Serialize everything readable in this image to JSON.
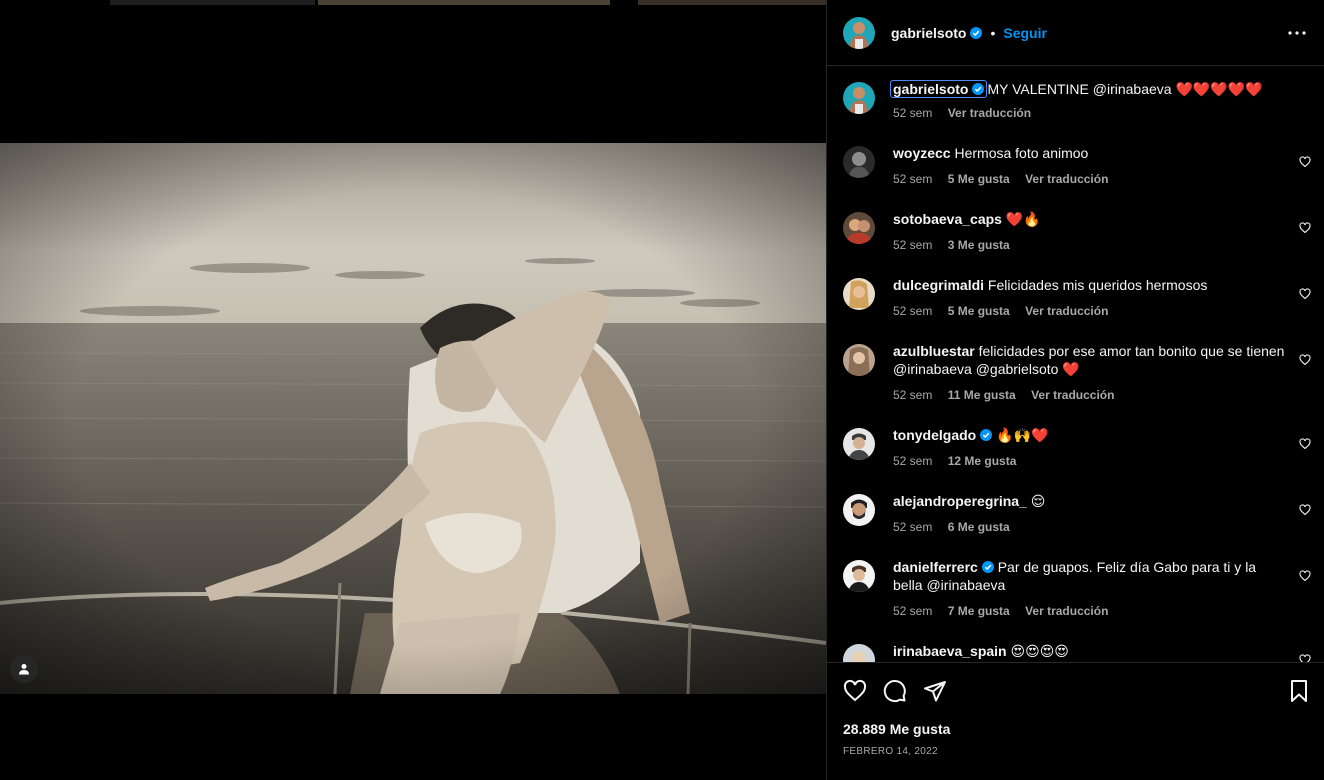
{
  "colors": {
    "accent": "#0095f6",
    "verified": "#0095f6",
    "text": "#f5f5f5",
    "muted": "#a8a8a8",
    "border": "#262626"
  },
  "media": {
    "tag_icon": "person-tag-icon"
  },
  "header": {
    "username": "gabrielsoto",
    "separator": "•",
    "follow_label": "Seguir",
    "more_icon": "more-horizontal-icon"
  },
  "caption": {
    "username": "gabrielsoto",
    "text": "MY VALENTINE @irinabaeva ❤️❤️❤️❤️❤️",
    "time": "52 sem",
    "translate": "Ver traducción"
  },
  "comments": [
    {
      "username": "woyzecc",
      "verified": false,
      "text": "Hermosa foto animoo",
      "time": "52 sem",
      "likes": "5 Me gusta",
      "translate": "Ver traducción"
    },
    {
      "username": "sotobaeva_caps",
      "verified": false,
      "text": "❤️🔥",
      "time": "52 sem",
      "likes": "3 Me gusta",
      "translate": ""
    },
    {
      "username": "dulcegrimaldi",
      "verified": false,
      "text": "Felicidades mis queridos hermosos",
      "time": "52 sem",
      "likes": "5 Me gusta",
      "translate": "Ver traducción"
    },
    {
      "username": "azulbluestar",
      "verified": false,
      "text": "felicidades por ese amor tan bonito que se tienen @irinabaeva @gabrielsoto ❤️",
      "time": "52 sem",
      "likes": "11 Me gusta",
      "translate": "Ver traducción"
    },
    {
      "username": "tonydelgado",
      "verified": true,
      "text": "🔥🙌❤️",
      "time": "52 sem",
      "likes": "12 Me gusta",
      "translate": ""
    },
    {
      "username": "alejandroperegrina_",
      "verified": false,
      "text": "😌",
      "time": "52 sem",
      "likes": "6 Me gusta",
      "translate": ""
    },
    {
      "username": "danielferrerc",
      "verified": true,
      "text": "Par de guapos. Feliz día Gabo para ti y la bella @irinabaeva",
      "time": "52 sem",
      "likes": "7 Me gusta",
      "translate": "Ver traducción"
    },
    {
      "username": "irinabaeva_spain",
      "verified": false,
      "text": "😍😍😍😍",
      "time": "",
      "likes": "",
      "translate": ""
    }
  ],
  "footer": {
    "likes": "28.889 Me gusta",
    "date": "FEBRERO 14, 2022",
    "icons": [
      "heart-icon",
      "comment-icon",
      "share-icon",
      "bookmark-icon"
    ]
  }
}
